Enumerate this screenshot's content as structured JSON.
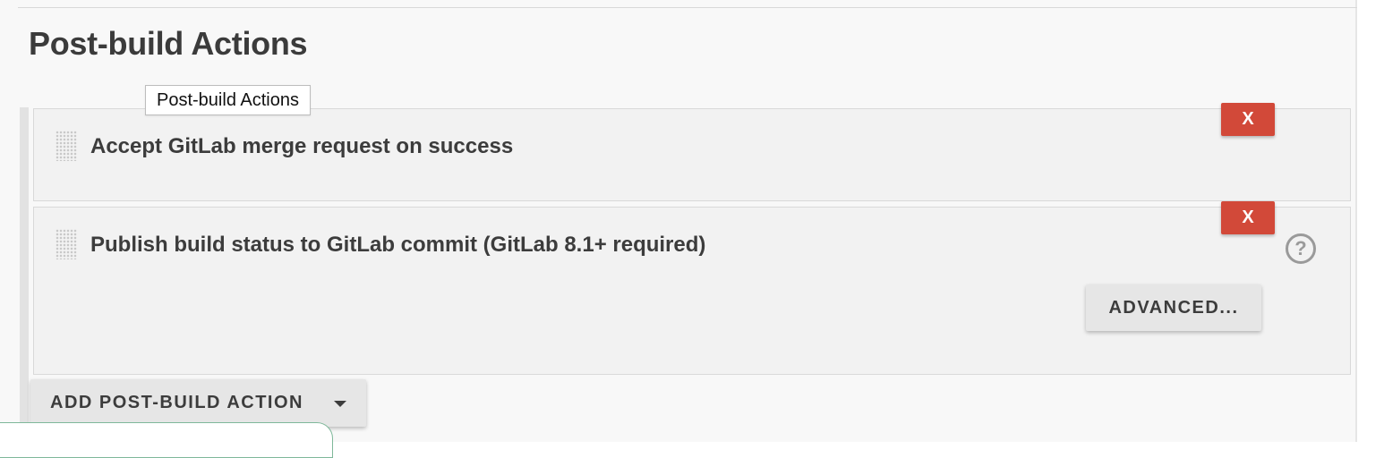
{
  "section": {
    "title": "Post-build Actions",
    "tooltip": "Post-build Actions"
  },
  "actions": [
    {
      "title": "Accept GitLab merge request on success",
      "delete_label": "X"
    },
    {
      "title": "Publish build status to GitLab commit (GitLab 8.1+ required)",
      "delete_label": "X",
      "help_label": "?",
      "advanced_label": "ADVANCED..."
    }
  ],
  "add_action": {
    "label": "ADD POST-BUILD ACTION"
  },
  "colors": {
    "delete_button": "#d24939",
    "button_background": "#e6e6e6",
    "panel_background": "#f8f8f8",
    "card_background": "#f2f2f2"
  },
  "icons": {
    "drag": "drag-handle-icon",
    "help": "help-icon",
    "dropdown": "caret-down-icon"
  }
}
